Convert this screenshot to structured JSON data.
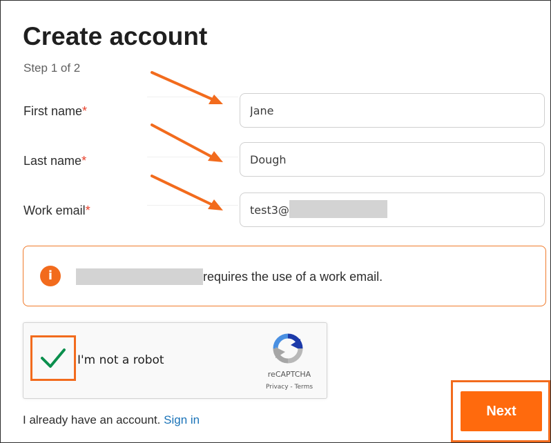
{
  "page": {
    "title": "Create account",
    "step": "Step 1 of 2"
  },
  "form": {
    "required_marker": "*",
    "first_name": {
      "label": "First name",
      "value": "Jane"
    },
    "last_name": {
      "label": "Last name",
      "value": "Dough"
    },
    "work_email": {
      "label": "Work email",
      "value": "test3@"
    }
  },
  "notice": {
    "icon": "info-icon",
    "icon_glyph": "i",
    "text": "requires the use of a work email."
  },
  "recaptcha": {
    "checked": true,
    "label": "I'm not a robot",
    "brand": "reCAPTCHA",
    "links": "Privacy - Terms"
  },
  "footer": {
    "signin_prompt": "I already have an account.",
    "signin_link": "Sign in",
    "next_label": "Next"
  },
  "colors": {
    "accent": "#ff6a0d",
    "annotation": "#f26b1d",
    "required": "#e8412c",
    "link": "#1a73b8",
    "check": "#0b8f4d"
  }
}
